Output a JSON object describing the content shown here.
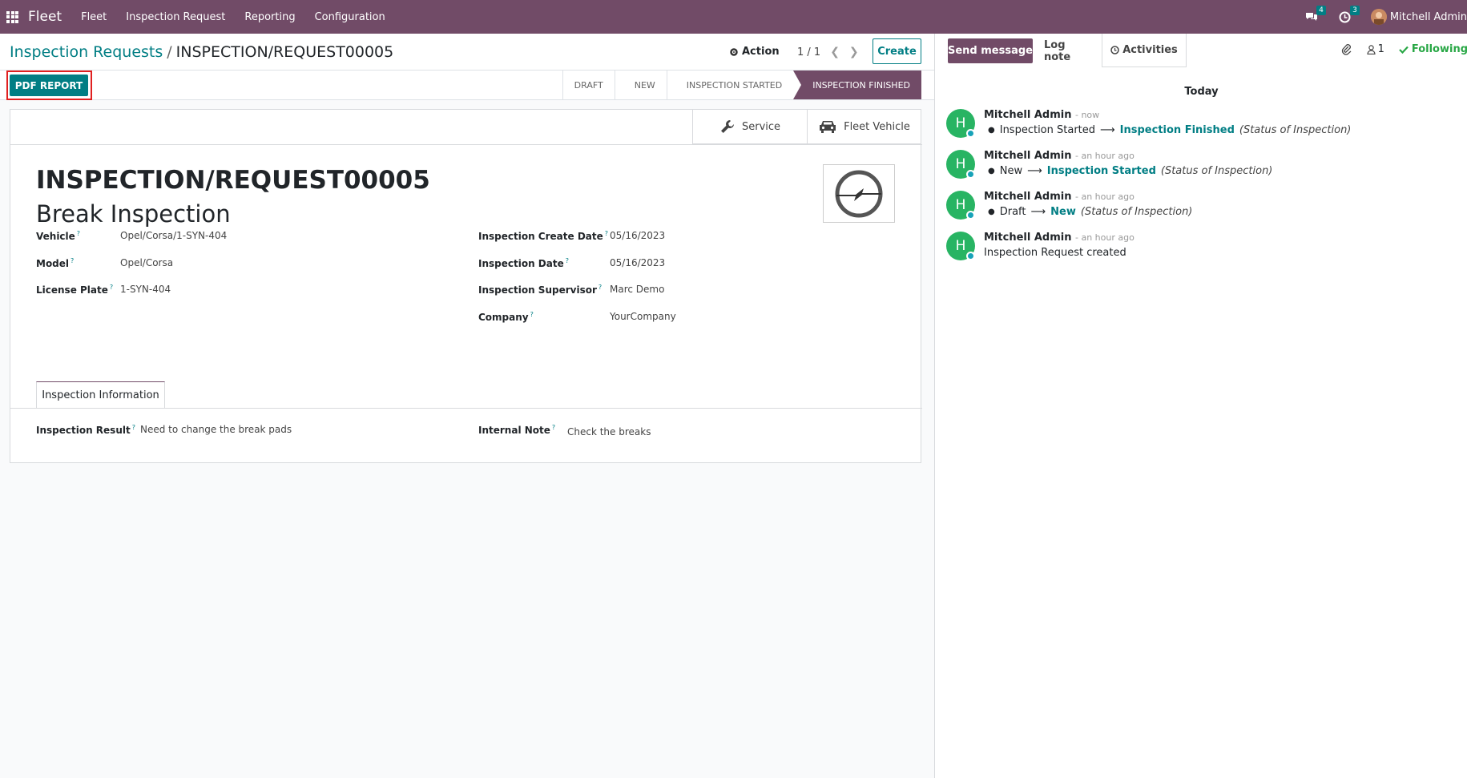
{
  "navbar": {
    "brand": "Fleet",
    "menu": [
      "Fleet",
      "Inspection Request",
      "Reporting",
      "Configuration"
    ],
    "messages_badge": "4",
    "activities_badge": "3",
    "user_name": "Mitchell Admin"
  },
  "control_panel": {
    "breadcrumb_parent": "Inspection Requests",
    "breadcrumb_separator": "/",
    "breadcrumb_current": "INSPECTION/REQUEST00005",
    "action_label": "Action",
    "pager": "1 / 1",
    "create_label": "Create",
    "pdf_report_label": "PDF REPORT"
  },
  "statusbar": {
    "stages": [
      "DRAFT",
      "NEW",
      "INSPECTION STARTED",
      "INSPECTION FINISHED"
    ],
    "active_stage": "INSPECTION FINISHED"
  },
  "smart_buttons": {
    "service": "Service",
    "fleet_vehicle": "Fleet Vehicle"
  },
  "record": {
    "name": "INSPECTION/REQUEST00005",
    "subtitle": "Break Inspection",
    "fields_left": [
      {
        "label": "Vehicle",
        "value": "Opel/Corsa/1-SYN-404"
      },
      {
        "label": "Model",
        "value": "Opel/Corsa"
      },
      {
        "label": "License Plate",
        "value": "1-SYN-404"
      }
    ],
    "fields_right": [
      {
        "label": "Inspection Create Date",
        "value": "05/16/2023"
      },
      {
        "label": "Inspection Date",
        "value": "05/16/2023"
      },
      {
        "label": "Inspection Supervisor",
        "value": "Marc Demo"
      },
      {
        "label": "Company",
        "value": "YourCompany"
      }
    ],
    "help_mark": "?"
  },
  "notebook": {
    "tab_label": "Inspection Information",
    "result_label": "Inspection Result",
    "result_value": "Need to change the break pads",
    "note_label": "Internal Note",
    "note_value": "Check the breaks"
  },
  "chatter": {
    "send_message": "Send message",
    "log_note": "Log note",
    "activities": "Activities",
    "followers_count": "1",
    "following": "Following",
    "date_separator": "Today",
    "messages": [
      {
        "author": "Mitchell Admin",
        "time": "- now",
        "old": "Inspection Started",
        "new": "Inspection Finished",
        "field": "(Status of Inspection)"
      },
      {
        "author": "Mitchell Admin",
        "time": "- an hour ago",
        "old": "New",
        "new": "Inspection Started",
        "field": "(Status of Inspection)"
      },
      {
        "author": "Mitchell Admin",
        "time": "- an hour ago",
        "old": "Draft",
        "new": "New",
        "field": "(Status of Inspection)"
      },
      {
        "author": "Mitchell Admin",
        "time": "- an hour ago",
        "text": "Inspection Request created"
      }
    ],
    "avatar_initial": "H"
  },
  "colors": {
    "brand": "#714b67",
    "accent": "#017e84",
    "highlight": "#e02020",
    "following": "#28a745"
  }
}
